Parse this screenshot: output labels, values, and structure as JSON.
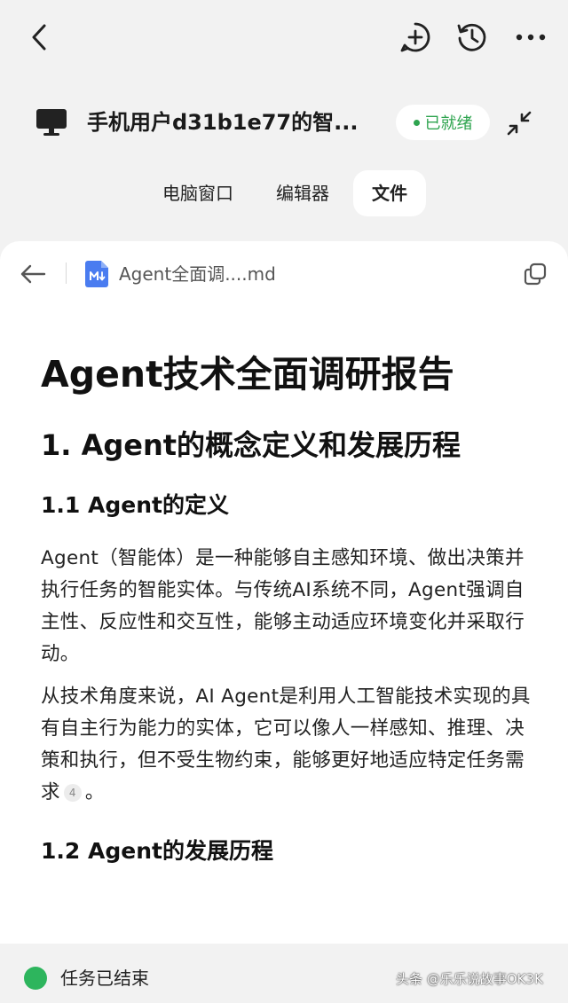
{
  "session": {
    "title": "手机用户d31b1e77的智...",
    "status": "已就绪"
  },
  "tabs": [
    {
      "label": "电脑窗口",
      "active": false
    },
    {
      "label": "编辑器",
      "active": false
    },
    {
      "label": "文件",
      "active": true
    }
  ],
  "file": {
    "name": "Agent全面调....md"
  },
  "document": {
    "title": "Agent技术全面调研报告",
    "section1": "1. Agent的概念定义和发展历程",
    "sub1_1": "1.1 Agent的定义",
    "para1": "Agent（智能体）是一种能够自主感知环境、做出决策并执行任务的智能实体。与传统AI系统不同，Agent强调自主性、反应性和交互性，能够主动适应环境变化并采取行动。",
    "para2": "从技术角度来说，AI Agent是利用人工智能技术实现的具有自主行为能力的实体，它可以像人一样感知、推理、决策和执行，但不受生物约束，能够更好地适应特定任务需求",
    "para2_cite": "4",
    "para2_end": "。",
    "sub1_2": "1.2 Agent的发展历程"
  },
  "footer": {
    "task_status": "任务已结束",
    "watermark": "头条 @乐乐说故事OK3K"
  },
  "colors": {
    "status_green": "#2ea44f",
    "task_green": "#2db55d",
    "background": "#f2f2f2",
    "md_icon_blue": "#4a7cf0"
  },
  "icons": [
    "back-chevron-icon",
    "add-chat-icon",
    "history-icon",
    "more-icon",
    "monitor-icon",
    "collapse-icon",
    "back-arrow-icon",
    "markdown-file-icon",
    "copy-icon"
  ]
}
